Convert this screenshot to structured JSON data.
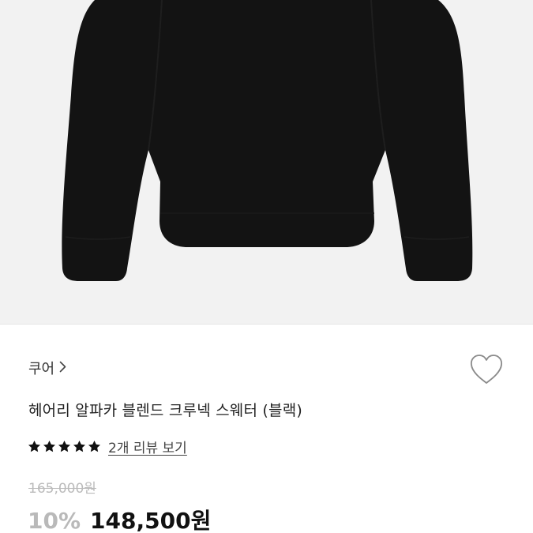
{
  "product": {
    "image_alt": "black crewneck sweater",
    "brand": "쿠어",
    "brand_chevron_icon": "chevron-right-icon",
    "wish_icon": "heart-outline-icon",
    "name": "헤어리 알파카 블렌드 크루넥 스웨터 (블랙)",
    "rating": {
      "stars": 5,
      "max": 5,
      "star_color": "#111111"
    },
    "review_link": "2개 리뷰 보기",
    "original_price": "165,000원",
    "discount": "10%",
    "sale_price": "148,500원"
  }
}
